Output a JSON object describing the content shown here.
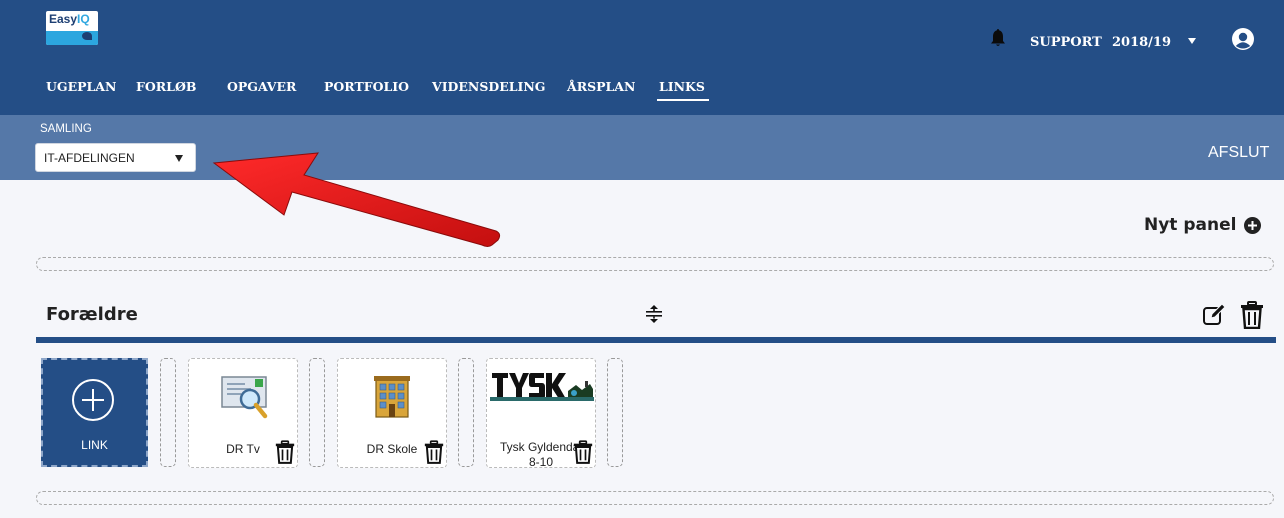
{
  "logo": {
    "text_a": "Easy",
    "text_b": "IQ"
  },
  "header": {
    "support_label": "SUPPORT",
    "year_label": "2018/19",
    "icons": {
      "notifications": "bell-icon",
      "year_dropdown": "caret-down-icon",
      "user": "user-avatar-icon"
    }
  },
  "nav": {
    "items": [
      {
        "label": "UGEPLAN",
        "active": false
      },
      {
        "label": "FORLØB",
        "active": false
      },
      {
        "label": "OPGAVER",
        "active": false
      },
      {
        "label": "PORTFOLIO",
        "active": false
      },
      {
        "label": "VIDENSDELING",
        "active": false
      },
      {
        "label": "ÅRSPLAN",
        "active": false
      },
      {
        "label": "LINKS",
        "active": true
      }
    ]
  },
  "toolbar": {
    "samling_label": "SAMLING",
    "samling_value": "IT-AFDELINGEN",
    "afslut_label": "AFSLUT"
  },
  "actions": {
    "new_panel_label": "Nyt panel"
  },
  "panel": {
    "title": "Forældre",
    "add_tile_label": "LINK",
    "links": [
      {
        "label": "DR Tv",
        "icon": "magnifier-document-icon"
      },
      {
        "label": "DR Skole",
        "icon": "school-building-icon"
      },
      {
        "label": "Tysk Gyldendal 8-10",
        "label_line1": "Tysk Gyldendal",
        "label_line2": "8-10",
        "icon": "tysk-logo-image"
      }
    ]
  },
  "colors": {
    "primary": "#244e86",
    "subbar": "#5578a8",
    "background": "#f5f6fa",
    "arrow": "#e41a1a"
  }
}
